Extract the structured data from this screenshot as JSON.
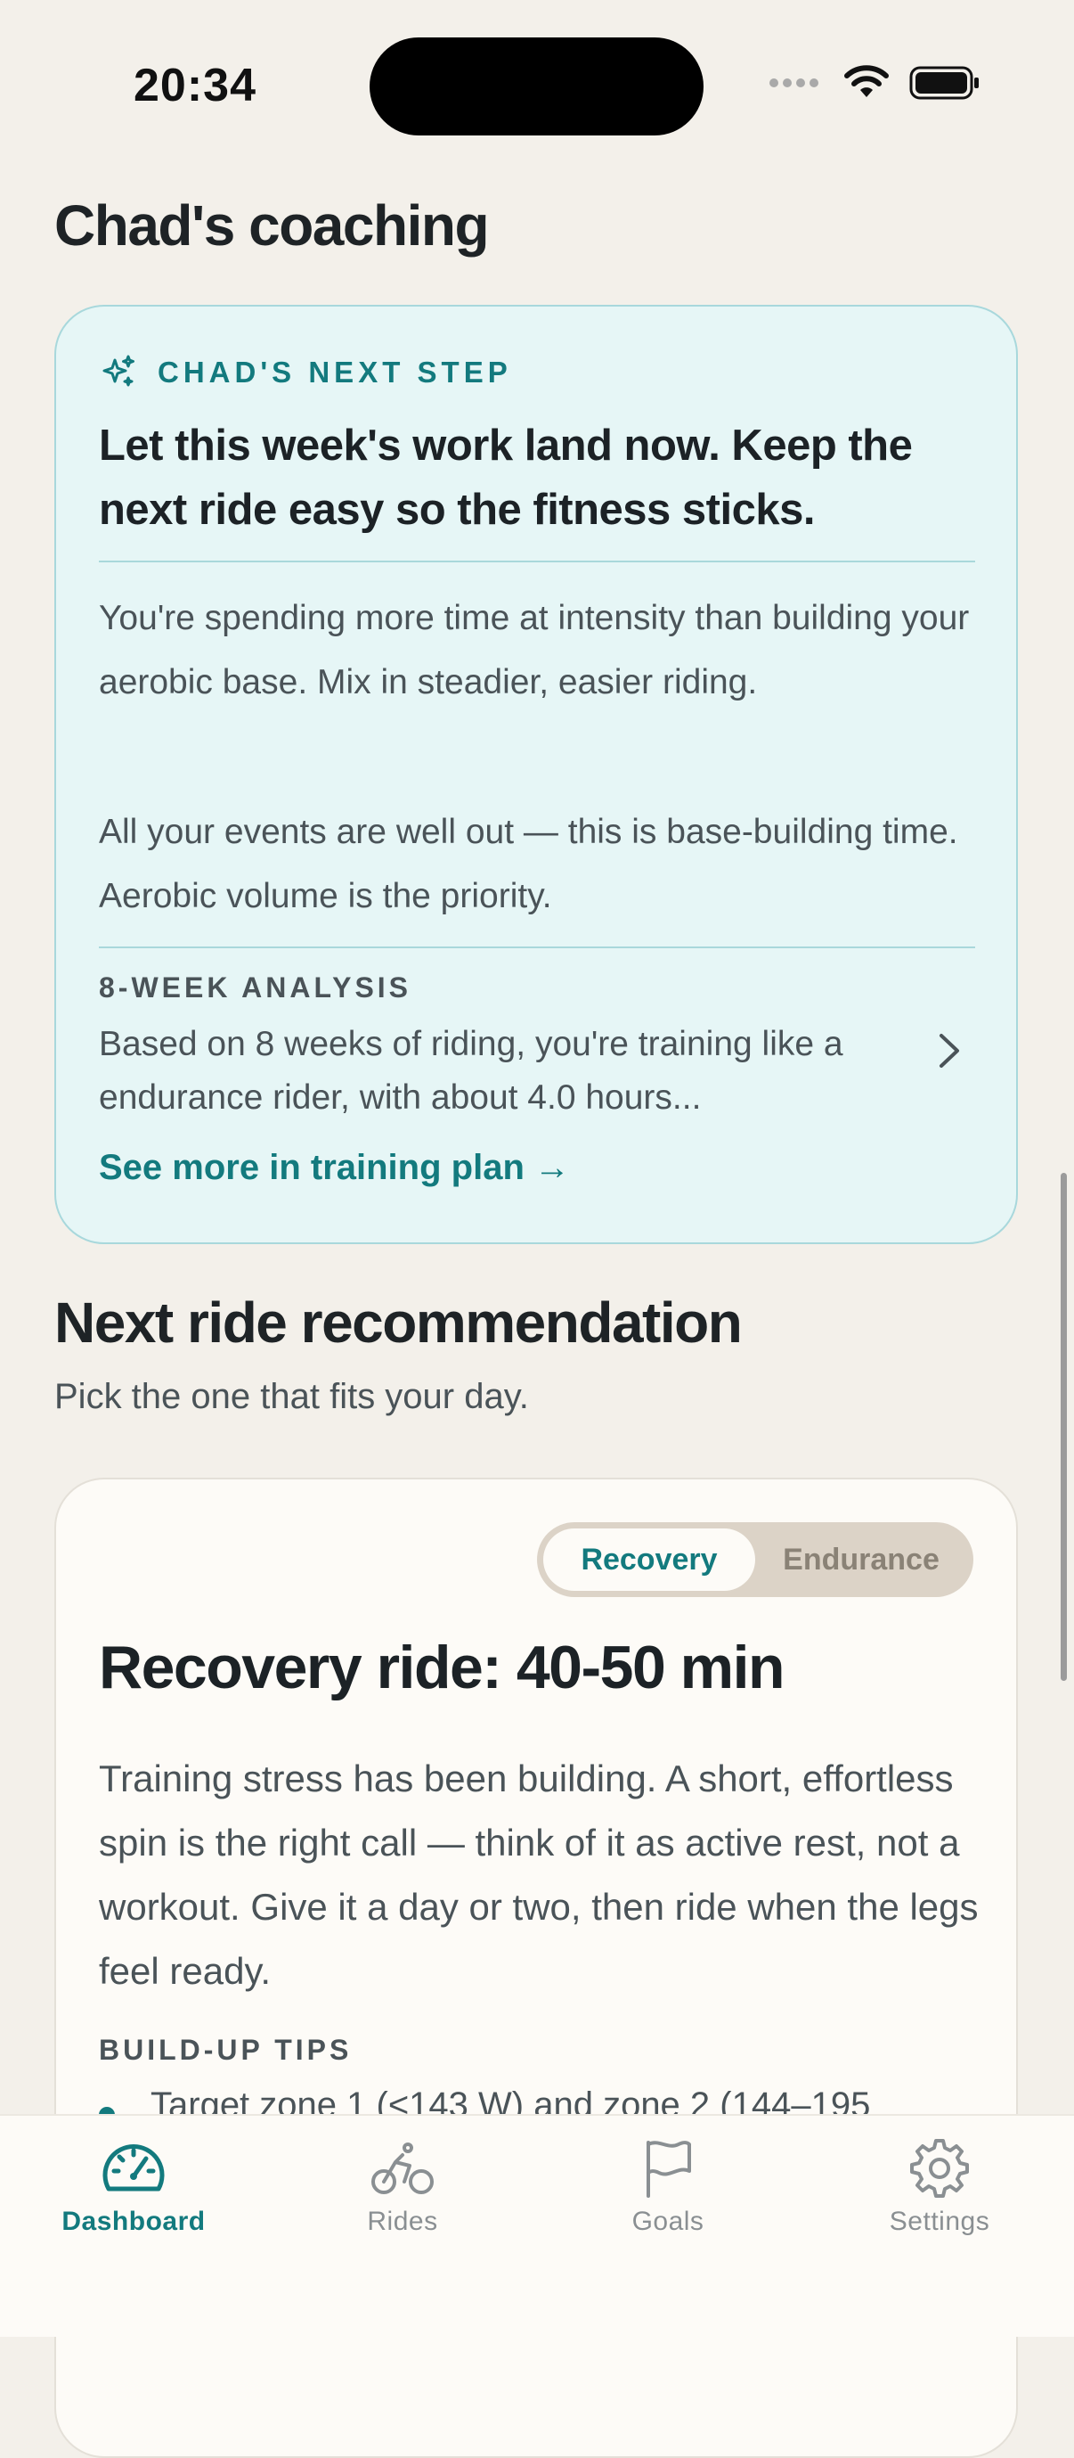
{
  "status_bar": {
    "time": "20:34"
  },
  "coaching": {
    "section_title": "Chad's coaching",
    "eyebrow": "CHAD'S NEXT STEP",
    "headline": "Let this week's work land now. Keep the next ride easy so the fitness sticks.",
    "paragraphs": [
      "You're spending more time at intensity than building your aerobic base. Mix in steadier, easier riding.",
      "All your events are well out — this is base-building time. Aerobic volume is the priority."
    ],
    "analysis_label": "8-WEEK ANALYSIS",
    "analysis_text": "Based on 8 weeks of riding, you're training like a endurance rider, with about 4.0 hours...",
    "see_more": "See more in training plan →",
    "accent_color": "#137A7E"
  },
  "recommendation": {
    "section_title": "Next ride recommendation",
    "subtitle": "Pick the one that fits your day.",
    "options": [
      "Recovery",
      "Endurance"
    ],
    "selected_option": "Recovery",
    "title": "Recovery ride: 40-50 min",
    "body": "Training stress has been building. A short, effortless spin is the right call — think of it as active rest, not a workout. Give it a day or two, then ride when the legs feel ready.",
    "tips_label": "BUILD-UP TIPS",
    "tips": [
      "Target zone 1 (<143 W) and zone 2 (144–195"
    ]
  },
  "tab_bar": {
    "items": [
      {
        "label": "Dashboard",
        "icon": "gauge-icon",
        "active": true
      },
      {
        "label": "Rides",
        "icon": "bicycle-icon",
        "active": false
      },
      {
        "label": "Goals",
        "icon": "flag-icon",
        "active": false
      },
      {
        "label": "Settings",
        "icon": "gear-icon",
        "active": false
      }
    ]
  }
}
